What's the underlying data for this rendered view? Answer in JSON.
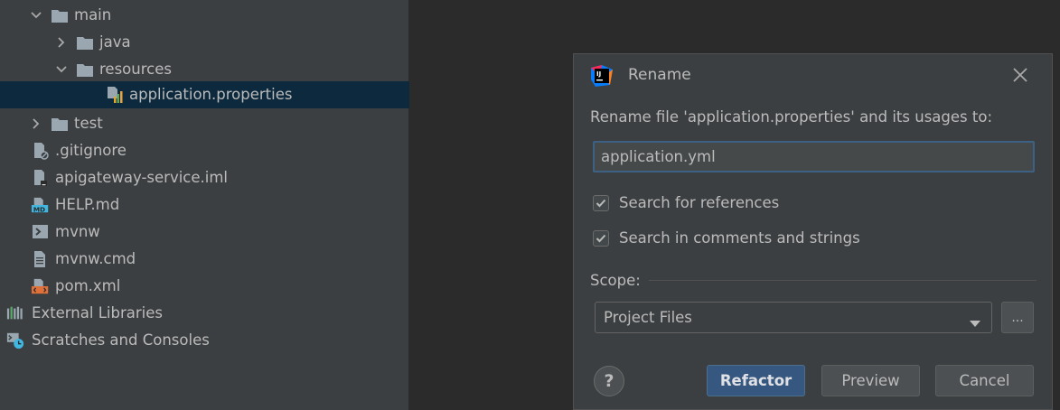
{
  "project_tree": {
    "items": [
      {
        "label": "main",
        "icon": "folder-icon",
        "chevron": "down"
      },
      {
        "label": "java",
        "icon": "folder-icon",
        "chevron": "right"
      },
      {
        "label": "resources",
        "icon": "folder-icon",
        "chevron": "down"
      },
      {
        "label": "application.properties",
        "icon": "properties-file-icon",
        "selected": true
      },
      {
        "label": "test",
        "icon": "folder-icon",
        "chevron": "right"
      },
      {
        "label": ".gitignore",
        "icon": "gitignore-file-icon"
      },
      {
        "label": "apigateway-service.iml",
        "icon": "iml-file-icon"
      },
      {
        "label": "HELP.md",
        "icon": "markdown-file-icon"
      },
      {
        "label": "mvnw",
        "icon": "shell-script-icon"
      },
      {
        "label": "mvnw.cmd",
        "icon": "text-file-icon"
      },
      {
        "label": "pom.xml",
        "icon": "xml-file-icon"
      },
      {
        "label": "External Libraries",
        "icon": "libraries-icon"
      },
      {
        "label": "Scratches and Consoles",
        "icon": "scratches-icon"
      }
    ]
  },
  "dialog": {
    "title": "Rename",
    "prompt": "Rename file 'application.properties' and its usages to:",
    "new_name": "application.yml",
    "search_references": {
      "label": "Search for references",
      "checked": true
    },
    "search_comments": {
      "label": "Search in comments and strings",
      "checked": true
    },
    "scope_label": "Scope:",
    "scope_value": "Project Files",
    "more_label": "...",
    "help_label": "?",
    "refactor_label": "Refactor",
    "preview_label": "Preview",
    "cancel_label": "Cancel"
  },
  "colors": {
    "panel_bg": "#3c3f41",
    "editor_bg": "#2b2b2b",
    "selection_bg": "#0d293e",
    "accent_button": "#365880",
    "focus_border": "#3d6185"
  }
}
